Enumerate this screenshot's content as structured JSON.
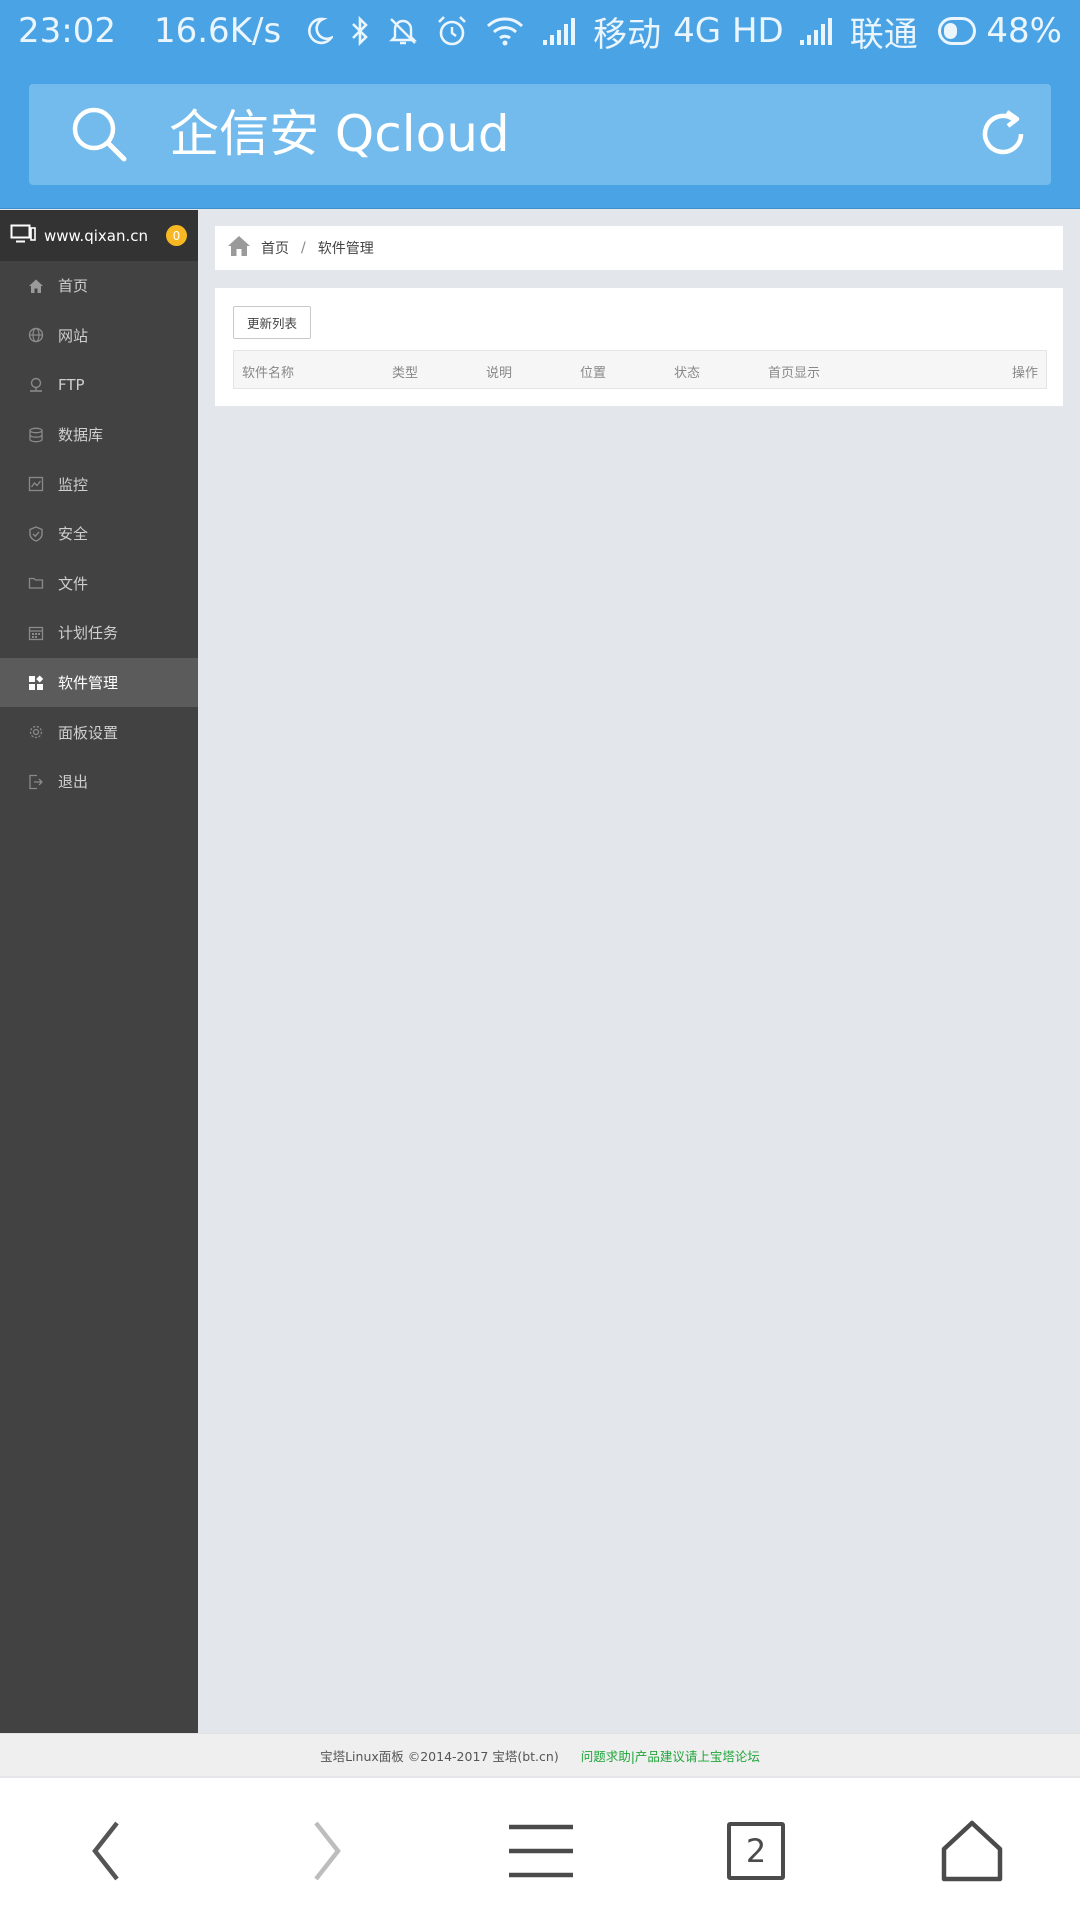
{
  "status_bar": {
    "time": "23:02",
    "speed": "16.6K/s",
    "carrier1": "移动",
    "network1": "4G HD",
    "carrier2": "联通",
    "battery": "48%",
    "battery_level": 0.48,
    "icons": [
      "moon-icon",
      "bluetooth-icon",
      "bell-off-icon",
      "alarm-icon",
      "wifi-icon",
      "signal-icon",
      "signal-icon-2"
    ]
  },
  "browser": {
    "search_text": "企信安 Qcloud"
  },
  "sidebar": {
    "site": "www.qixan.cn",
    "badge": "0",
    "items": [
      {
        "label": "首页",
        "icon": "home-icon"
      },
      {
        "label": "网站",
        "icon": "globe-icon"
      },
      {
        "label": "FTP",
        "icon": "ftp-icon"
      },
      {
        "label": "数据库",
        "icon": "database-icon"
      },
      {
        "label": "监控",
        "icon": "monitor-icon"
      },
      {
        "label": "安全",
        "icon": "shield-icon"
      },
      {
        "label": "文件",
        "icon": "folder-icon"
      },
      {
        "label": "计划任务",
        "icon": "calendar-icon"
      },
      {
        "label": "软件管理",
        "icon": "apps-icon",
        "active": true
      },
      {
        "label": "面板设置",
        "icon": "gear-icon"
      },
      {
        "label": "退出",
        "icon": "logout-icon"
      }
    ]
  },
  "breadcrumb": {
    "home": "首页",
    "separator": "/",
    "current": "软件管理"
  },
  "panel": {
    "update_button": "更新列表",
    "columns": [
      "软件名称",
      "类型",
      "说明",
      "位置",
      "状态",
      "首页显示",
      "操作"
    ]
  },
  "footer": {
    "copyright": "宝塔Linux面板 ©2014-2017 宝塔(bt.cn)",
    "link": "问题求助|产品建议请上宝塔论坛"
  },
  "bottom_nav": {
    "tab_count": "2"
  },
  "colors": {
    "header_blue": "#4aa3e4",
    "sidebar_bg": "#424242",
    "active_item": "#5b5b5b",
    "badge": "#f7b824",
    "footer_link": "#20a53a"
  }
}
